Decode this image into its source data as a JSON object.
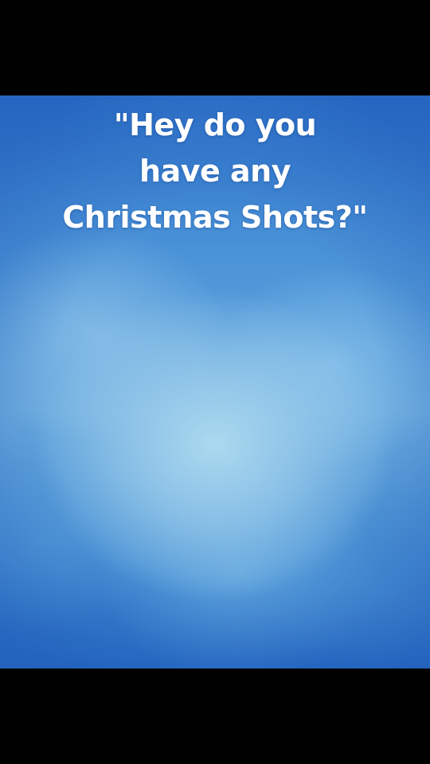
{
  "caption": {
    "lines": [
      "\"Hey do you",
      "have any",
      "Christmas Shots?\""
    ]
  },
  "colors": {
    "letterbox": "#000000",
    "background_blue": "#3f86d2",
    "background_light": "#a8d6ee",
    "caption_text": "#ffffff"
  }
}
